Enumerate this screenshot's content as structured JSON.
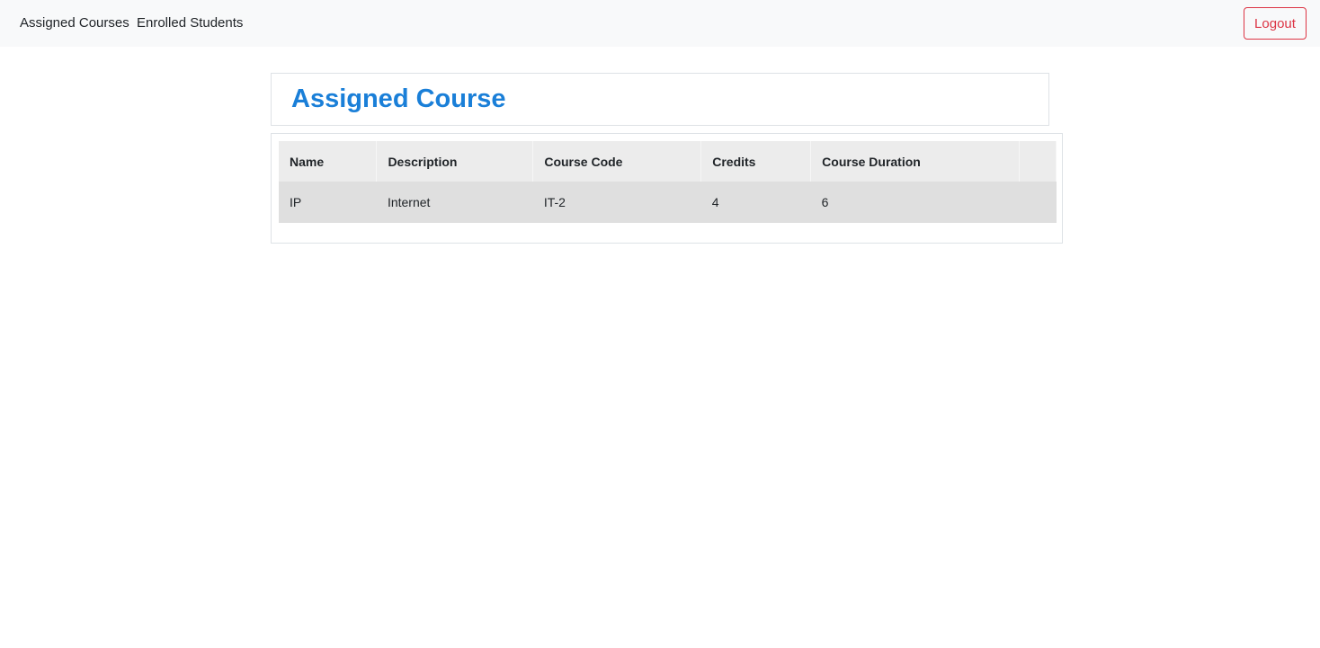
{
  "nav": {
    "assigned_courses": "Assigned Courses",
    "enrolled_students": "Enrolled Students",
    "logout": "Logout"
  },
  "page": {
    "title": "Assigned Course"
  },
  "table": {
    "headers": {
      "name": "Name",
      "description": "Description",
      "course_code": "Course Code",
      "credits": "Credits",
      "course_duration": "Course Duration"
    },
    "rows": [
      {
        "name": "IP",
        "description": "Internet",
        "course_code": "IT-2",
        "credits": "4",
        "course_duration": "6"
      }
    ]
  },
  "colors": {
    "accent": "#1a7fd8",
    "danger": "#dc3545",
    "navbar_bg": "#f8f9fa",
    "header_bg": "#ececec",
    "row_bg": "#dfdfdf"
  }
}
